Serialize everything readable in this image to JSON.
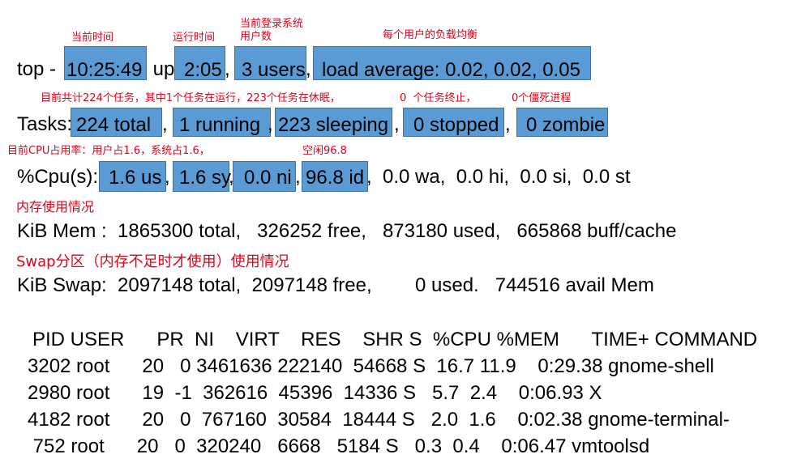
{
  "annotations": {
    "cur_time": "当前时间",
    "uptime": "运行时间",
    "users": "当前登录系统\n用户数",
    "load": "每个用户的负载均衡",
    "tasks": "目前共计224个任务，其中1个任务在运行，223个任务在休眠，",
    "stopped": "0  个任务终止，",
    "zombie": "0个僵死进程",
    "cpu": "目前CPU占用率：用户占1.6，系统占1.6，",
    "idle": "空闲96.8",
    "mem": "内存使用情况",
    "swap": "Swap分区（内存不足时才使用）使用情况"
  },
  "top_line": {
    "prefix": "top - ",
    "time": "10:25:49",
    "up": " up ",
    "uptime": "2:05",
    "sep1": ",",
    "users": "3 users",
    "sep2": ",",
    "load": "load average: 0.02, 0.02, 0.05"
  },
  "tasks_line": {
    "prefix": "Tasks:",
    "total": "224 total",
    "sep1": ",",
    "running": "1 running",
    "sep2": ",",
    "sleeping": "223 sleeping",
    "sep3": ",",
    "stopped": "0 stopped",
    "sep4": ",",
    "zombie": "0 zombie"
  },
  "cpu_line": {
    "prefix": "%Cpu(s):",
    "us": "1.6 us",
    "sep1": ",",
    "sy": "1.6 sy",
    "sep2": ",",
    "ni": "0.0 ni",
    "sep3": ",",
    "id": "96.8 id",
    "rest": ",  0.0 wa,  0.0 hi,  0.0 si,  0.0 st"
  },
  "mem_line": "KiB Mem :  1865300 total,   326252 free,   873180 used,   665868 buff/cache",
  "swap_line": "KiB Swap:  2097148 total,  2097148 free,        0 used.   744516 avail Mem",
  "process_table": {
    "header": "PID USER      PR  NI    VIRT    RES    SHR S  %CPU %MEM      TIME+ COMMAND",
    "rows": [
      "3202 root      20   0 3461636 222140  54668 S  16.7 11.9    0:29.38 gnome-shell",
      "2980 root      19  -1  362616  45396  14336 S   5.7  2.4    0:06.93 X",
      "4182 root      20   0  767160  30584  18444 S   2.0  1.6    0:02.38 gnome-terminal-",
      " 752 root      20   0  320240   6668   5184 S   0.3  0.4    0:06.47 vmtoolsd"
    ]
  }
}
